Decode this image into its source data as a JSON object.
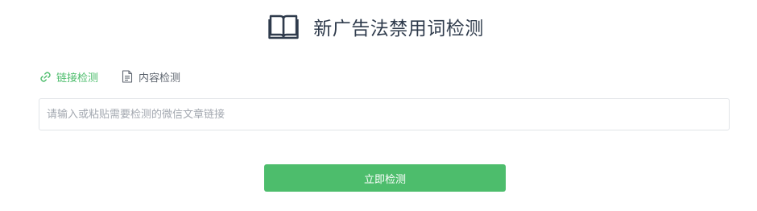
{
  "header": {
    "title": "新广告法禁用词检测",
    "icon": "open-book-icon"
  },
  "tabs": [
    {
      "label": "链接检测",
      "icon": "link-icon",
      "active": true
    },
    {
      "label": "内容检测",
      "icon": "document-icon",
      "active": false
    }
  ],
  "search": {
    "placeholder": "请输入或粘贴需要检测的微信文章链接",
    "value": ""
  },
  "actions": {
    "submit_label": "立即检测"
  },
  "colors": {
    "accent": "#4dbd6c",
    "title": "#2f3b4c",
    "muted": "#5f6670",
    "border": "#e1e4e8"
  }
}
